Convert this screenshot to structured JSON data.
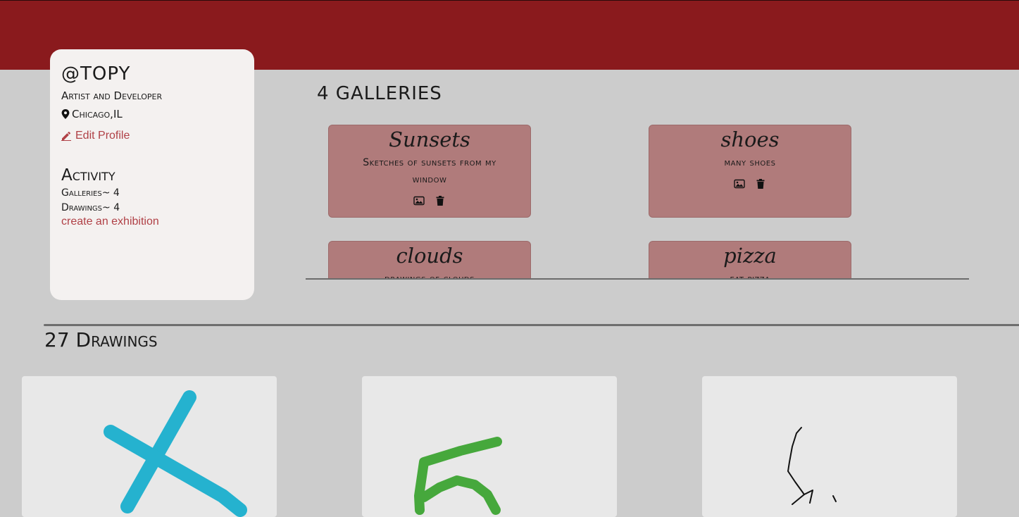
{
  "profile": {
    "username": "@TOPY",
    "tagline": "Artist and Developer",
    "location": "Chicago,IL",
    "location_icon": "map-pin-icon",
    "edit_label": "Edit Profile",
    "edit_icon": "pencil-icon",
    "activity_title": "Activity",
    "galleries_stat": "Galleries~ 4",
    "drawings_stat": "Drawings~ 4",
    "create_link": "create an exhibition"
  },
  "galleries": {
    "title": "4 GALLERIES",
    "items": [
      {
        "name": "Sunsets",
        "description": "Sketches of sunsets from my window"
      },
      {
        "name": "shoes",
        "description": "many shoes"
      },
      {
        "name": "clouds",
        "description": "drawings of clouds"
      },
      {
        "name": "pizza",
        "description": "eat pizza"
      }
    ]
  },
  "drawings": {
    "title": "27 Drawings",
    "items": [
      {
        "label": "blue-x-drawing",
        "stroke": "#25b2cf"
      },
      {
        "label": "green-5-drawing",
        "stroke": "#46a83c"
      },
      {
        "label": "black-line-drawing",
        "stroke": "#111111"
      }
    ]
  },
  "colors": {
    "header": "#8a1a1d",
    "accent_link": "#b04046",
    "gallery_card": "#b07b7b",
    "background": "#cccccc"
  }
}
